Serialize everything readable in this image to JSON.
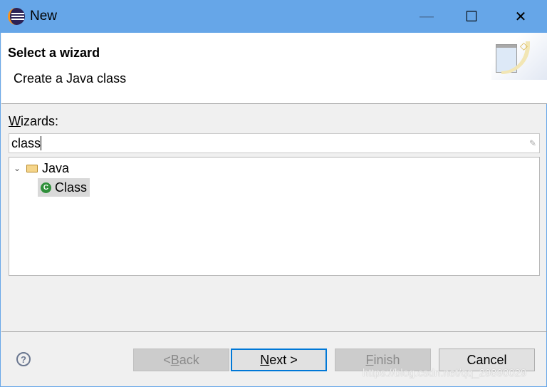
{
  "window": {
    "title": "New",
    "minimize": "—",
    "maximize": "☐",
    "close": "✕"
  },
  "header": {
    "title": "Select a wizard",
    "description": "Create a Java class"
  },
  "wizards": {
    "label_mnemonic": "W",
    "label_rest": "izards:",
    "filter_value": "class"
  },
  "tree": {
    "folder": "Java",
    "item": "Class"
  },
  "buttons": {
    "back_prefix": "< ",
    "back_mnemonic": "B",
    "back_rest": "ack",
    "next_mnemonic": "N",
    "next_rest": "ext >",
    "finish_mnemonic": "F",
    "finish_rest": "inish",
    "cancel": "Cancel",
    "help": "?"
  },
  "watermark": "https://blog.csdn.net/qq_29890029",
  "colors": {
    "titlebar": "#66a6e8",
    "default_button_border": "#0078d7"
  }
}
